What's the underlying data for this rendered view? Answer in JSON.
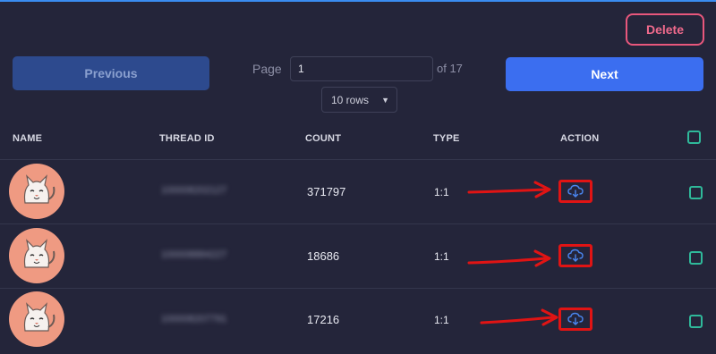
{
  "toolbar": {
    "delete_label": "Delete",
    "previous_label": "Previous",
    "next_label": "Next"
  },
  "pagination": {
    "page_label": "Page",
    "current_page": "1",
    "of_label": "of 17",
    "rows_selected": "10 rows"
  },
  "table": {
    "columns": [
      "NAME",
      "THREAD ID",
      "COUNT",
      "TYPE",
      "ACTION"
    ],
    "rows": [
      {
        "thread_id": "100008202127",
        "count": "371797",
        "type": "1:1"
      },
      {
        "thread_id": "100008884227",
        "count": "18686",
        "type": "1:1"
      },
      {
        "thread_id": "100008207791",
        "count": "17216",
        "type": "1:1"
      }
    ]
  },
  "colors": {
    "background": "#24253a",
    "primary": "#3b6ef0",
    "danger": "#e8577c",
    "checkbox": "#2fb99a",
    "annotation": "#e01414",
    "avatar": "#ef9a82"
  },
  "icons": {
    "action": "cloud-download-icon",
    "avatar": "cat-avatar-icon",
    "select_caret": "caret-down-icon"
  }
}
